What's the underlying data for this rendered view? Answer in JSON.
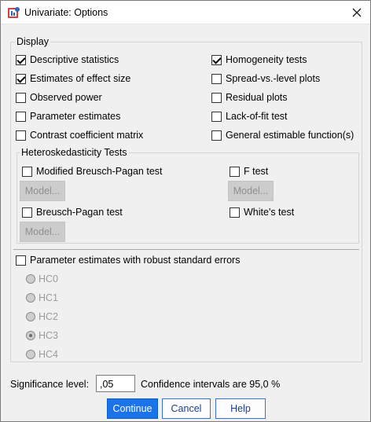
{
  "window": {
    "title": "Univariate: Options"
  },
  "display": {
    "label": "Display",
    "left": [
      {
        "label": "Descriptive statistics",
        "checked": true
      },
      {
        "label": "Estimates of effect size",
        "checked": true
      },
      {
        "label": "Observed power",
        "checked": false
      },
      {
        "label": "Parameter estimates",
        "checked": false
      },
      {
        "label": "Contrast coefficient matrix",
        "checked": false
      }
    ],
    "right": [
      {
        "label": "Homogeneity tests",
        "checked": true
      },
      {
        "label": "Spread-vs.-level plots",
        "checked": false
      },
      {
        "label": "Residual plots",
        "checked": false
      },
      {
        "label": "Lack-of-fit test",
        "checked": false
      },
      {
        "label": "General estimable function(s)",
        "checked": false
      }
    ]
  },
  "hetero": {
    "label": "Heteroskedasticity Tests",
    "modified_bp": {
      "label": "Modified Breusch-Pagan test",
      "checked": false
    },
    "f_test": {
      "label": "F test",
      "checked": false
    },
    "bp": {
      "label": "Breusch-Pagan test",
      "checked": false
    },
    "white": {
      "label": "White's test",
      "checked": false
    },
    "model_label": "Model..."
  },
  "robust": {
    "label": "Parameter estimates with robust standard errors",
    "checked": false,
    "options": [
      "HC0",
      "HC1",
      "HC2",
      "HC3",
      "HC4"
    ],
    "selected": "HC3"
  },
  "significance": {
    "label": "Significance level:",
    "value": ",05",
    "ci_text": "Confidence intervals are 95,0 %"
  },
  "buttons": {
    "continue": "Continue",
    "cancel": "Cancel",
    "help": "Help"
  },
  "colors": {
    "primary": "#1a73e8",
    "disabled_text": "#9b9b9b"
  }
}
